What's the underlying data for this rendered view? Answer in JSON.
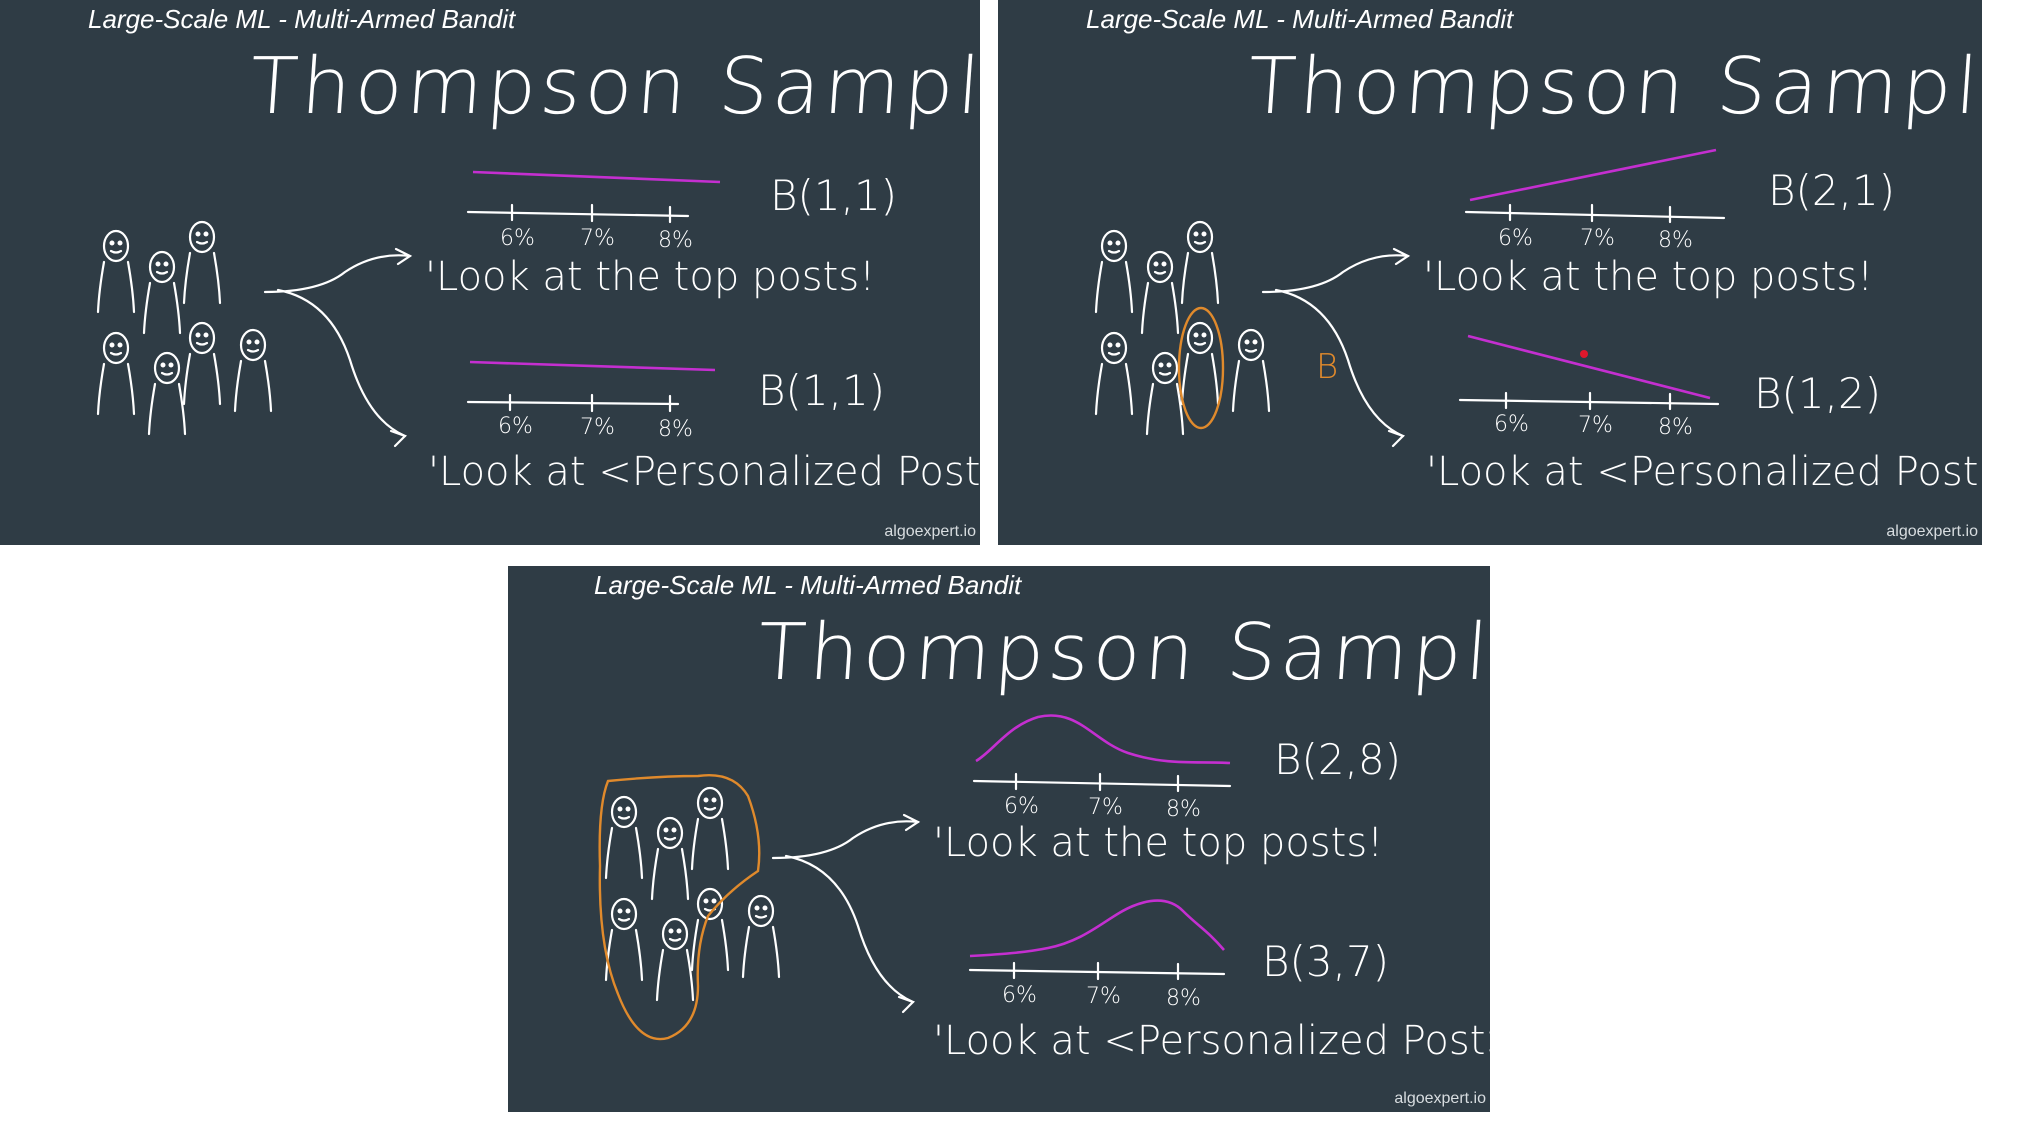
{
  "slides": [
    {
      "header": "Large-Scale ML - Multi-Armed Bandit",
      "title": "Thompson Sampling",
      "watermark": "algoexpert.io",
      "arms": [
        {
          "message": "'Look at the top posts!",
          "dist_label": "B(1,1)",
          "ticks": [
            "6%",
            "7%",
            "8%"
          ]
        },
        {
          "message": "'Look at <Personalized Post>'",
          "dist_label": "B(1,1)",
          "ticks": [
            "6%",
            "7%",
            "8%"
          ]
        }
      ]
    },
    {
      "header": "Large-Scale ML - Multi-Armed Bandit",
      "title": "Thompson Sampling",
      "watermark": "algoexpert.io",
      "annotation": "B",
      "arms": [
        {
          "message": "'Look at the top posts!",
          "dist_label": "B(2,1)",
          "ticks": [
            "6%",
            "7%",
            "8%"
          ]
        },
        {
          "message": "'Look at <Personalized Post>'",
          "dist_label": "B(1,2)",
          "ticks": [
            "6%",
            "7%",
            "8%"
          ]
        }
      ]
    },
    {
      "header": "Large-Scale ML - Multi-Armed Bandit",
      "title": "Thompson Sampling",
      "watermark": "algoexpert.io",
      "arms": [
        {
          "message": "'Look at the top posts!",
          "dist_label": "B(2,8)",
          "ticks": [
            "6%",
            "7%",
            "8%"
          ]
        },
        {
          "message": "'Look at <Personalized Post>'",
          "dist_label": "B(3,7)",
          "ticks": [
            "6%",
            "7%",
            "8%"
          ]
        }
      ]
    }
  ],
  "colors": {
    "background": "#2f3c45",
    "chalk": "#ffffff",
    "curve": "#c42fd0",
    "highlight": "#e08a2c",
    "sample_point": "#e0182c"
  },
  "icons": [
    "stick-figure-icon",
    "arrow-icon"
  ]
}
